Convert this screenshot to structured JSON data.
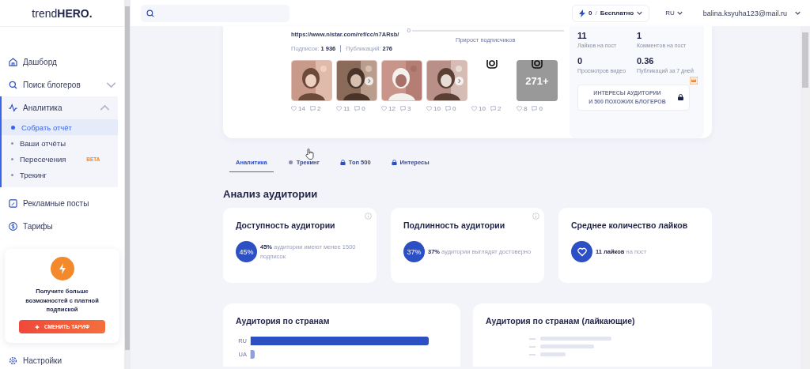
{
  "sidebar": {
    "logo": {
      "light": "trend",
      "bold": "HERO."
    },
    "items": [
      {
        "label": "Дашборд",
        "expanded": false,
        "chevron": false
      },
      {
        "label": "Поиск блогеров",
        "expanded": false,
        "chevron": true
      },
      {
        "label": "Аналитика",
        "expanded": true,
        "chevron": true,
        "children": [
          {
            "label": "Собрать отчёт",
            "selected": true
          },
          {
            "label": "Ваши отчёты",
            "selected": false
          },
          {
            "label": "Пересечения",
            "selected": false,
            "badge": "BETA"
          },
          {
            "label": "Трекинг",
            "selected": false
          }
        ]
      },
      {
        "label": "Рекламные посты",
        "expanded": false,
        "chevron": false
      },
      {
        "label": "Тарифы",
        "expanded": false,
        "chevron": false
      }
    ],
    "promo": {
      "text": "Получите больше возможностей с платной подпиской",
      "button": "СМЕНИТЬ ТАРИФ"
    },
    "footer_item": {
      "label": "Настройки"
    }
  },
  "topbar": {
    "credits": "0",
    "separator": "/",
    "plan": "Бесплатно",
    "language": "RU",
    "email": "balina.ksyuha123@mail.ru"
  },
  "profile": {
    "url": "https://www.nlstar.com/ref/cc/n7ARsb/",
    "stats": [
      {
        "label": "Подписок:",
        "value": "1 936"
      },
      {
        "label": "Публикаций:",
        "value": "276"
      }
    ],
    "growth": {
      "axis_label": "0",
      "caption": "Прирост подписчиков"
    },
    "posts": [
      {
        "kind": "picture",
        "likes": "14",
        "comments": "2"
      },
      {
        "kind": "picture",
        "likes": "11",
        "comments": "0",
        "carousel": true
      },
      {
        "kind": "picture",
        "likes": "12",
        "comments": "3"
      },
      {
        "kind": "picture",
        "likes": "10",
        "comments": "0",
        "carousel": true
      },
      {
        "kind": "placeholder",
        "likes": "10",
        "comments": "2"
      },
      {
        "kind": "placeholder",
        "likes": "8",
        "comments": "0",
        "overlay": "271+"
      }
    ],
    "metrics": [
      {
        "value": "11",
        "label": "Лайков на пост"
      },
      {
        "value": "1",
        "label": "Комментов на пост"
      },
      {
        "value": "0",
        "label": "Просмотров видео"
      },
      {
        "value": "0.36",
        "label": "Публикаций за 7 дней"
      }
    ],
    "locked_button": {
      "lines": [
        "ИНТЕРЕСЫ АУДИТОРИИ",
        "И 500 ПОХОЖИХ БЛОГЕРОВ"
      ]
    }
  },
  "tabs": [
    {
      "label": "Аналитика",
      "selected": true,
      "kind": "plain"
    },
    {
      "label": "Трекинг",
      "selected": false,
      "kind": "tracking"
    },
    {
      "label": "Топ 500",
      "selected": false,
      "kind": "locked"
    },
    {
      "label": "Интересы",
      "selected": false,
      "kind": "locked"
    }
  ],
  "section_title": "Анализ аудитории",
  "cards": [
    {
      "title": "Доступность аудитории",
      "kind": "percent",
      "badge": "45%",
      "bold": "45%",
      "text": " аудитории имеют менее 1500 подписок",
      "info": true
    },
    {
      "title": "Подлинность аудитории",
      "kind": "percent",
      "badge": "37%",
      "bold": "37%",
      "text": " аудитории выглядят достоверно",
      "info": true
    },
    {
      "title": "Среднее количество лайков",
      "kind": "heart",
      "bold": "11 лайков",
      "text": " на пост",
      "info": false
    }
  ],
  "country_cards": [
    {
      "title": "Аудитория по странам",
      "kind": "bars",
      "rows": [
        {
          "label": "RU",
          "level": 0.98
        },
        {
          "label": "UA",
          "level": 0.02
        }
      ]
    },
    {
      "title": "Аудитория по странам (лайкающие)",
      "kind": "loading"
    }
  ]
}
